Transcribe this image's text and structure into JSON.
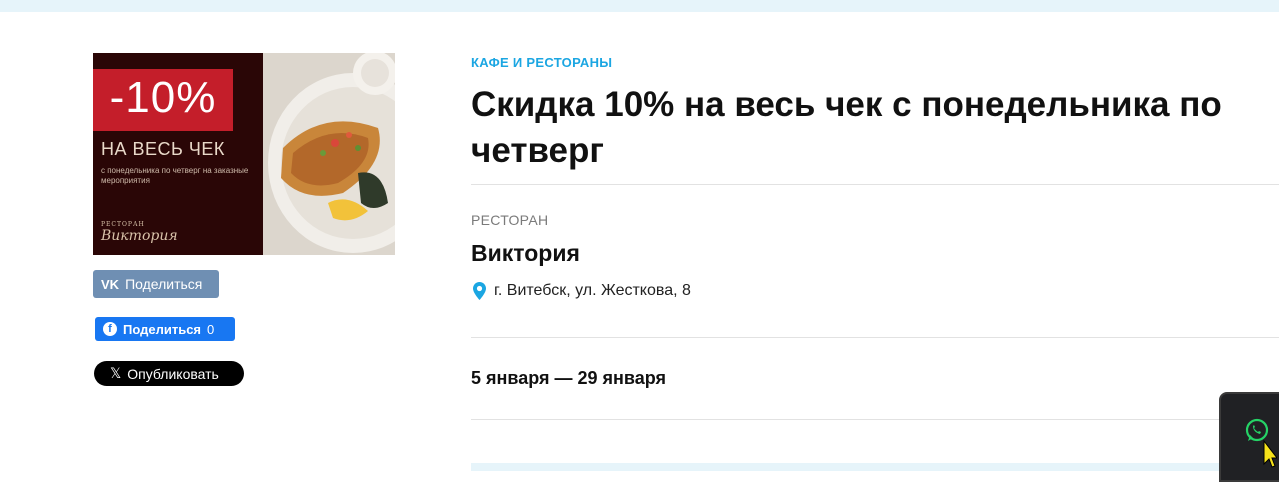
{
  "promo": {
    "percent": "-10%",
    "headline": "НА ВЕСЬ ЧЕК",
    "subline": "с понедельника по четверг на заказные мероприятия",
    "brand_small": "РЕСТОРАН",
    "brand": "Виктория"
  },
  "share": {
    "vk_logo": "VK",
    "vk_label": "Поделиться",
    "fb_label": "Поделиться",
    "fb_count": "0",
    "x_label": "Опубликовать"
  },
  "offer": {
    "category": "КАФЕ И РЕСТОРАНЫ",
    "title": "Скидка 10% на весь чек с понедельника по четверг",
    "place_type": "РЕСТОРАН",
    "place_name": "Виктория",
    "address": "г. Витебск, ул. Жесткова, 8",
    "dates": "5 января — 29 января"
  },
  "icons": {
    "pin": "map-pin-icon",
    "whatsapp": "whatsapp-icon",
    "vk": "vk-icon",
    "facebook": "facebook-icon",
    "x": "x-logo-icon"
  },
  "colors": {
    "accent": "#1ba6e2",
    "vk": "#6f8fb3",
    "facebook": "#1877f2",
    "promo_red": "#c41e2a"
  }
}
